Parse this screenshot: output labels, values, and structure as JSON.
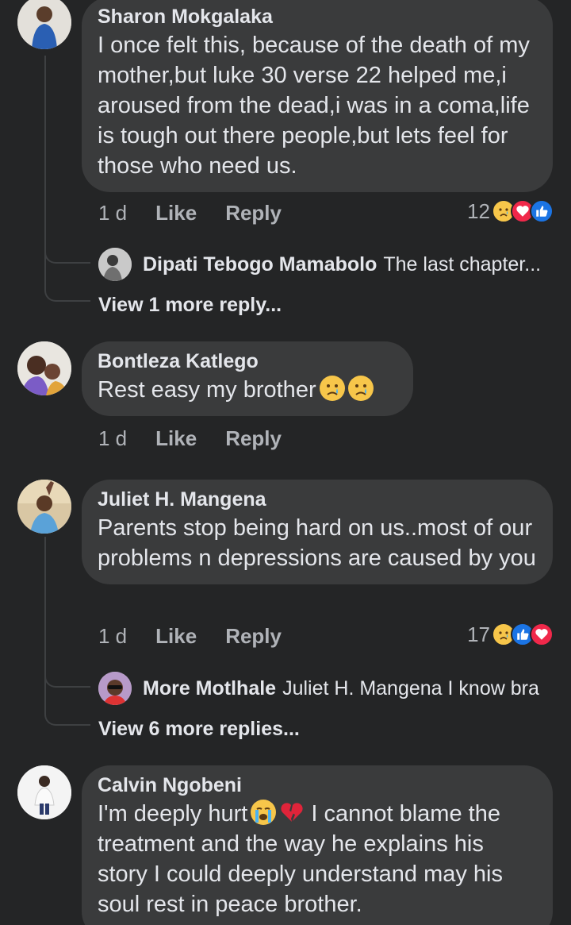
{
  "comments": [
    {
      "author": "Sharon Mokgalaka",
      "text": "I once felt this, because of the death of my mother,but luke 30 verse 22 helped me,i aroused from the dead,i was in a coma,life is tough out there people,but lets feel for those who need us.",
      "time": "1 d",
      "like_label": "Like",
      "reply_label": "Reply",
      "reaction_count": "12",
      "reactions": [
        "sad",
        "love",
        "like"
      ],
      "reply_preview": {
        "author": "Dipati Tebogo Mamabolo",
        "text": "The last chapter..."
      },
      "more_replies": "View 1 more reply..."
    },
    {
      "author": "Bontleza Katlego",
      "text": "Rest easy my brother 😢😢",
      "time": "1 d",
      "like_label": "Like",
      "reply_label": "Reply"
    },
    {
      "author": "Juliet H. Mangena",
      "text": "Parents stop being hard on us..most of our problems n depressions are caused by you",
      "time": "1 d",
      "like_label": "Like",
      "reply_label": "Reply",
      "reaction_count": "17",
      "reactions": [
        "sad",
        "like",
        "love"
      ],
      "reply_preview": {
        "author": "More Motlhale",
        "text": "Juliet H. Mangena I know bra"
      },
      "more_replies": "View 6 more replies..."
    },
    {
      "author": "Calvin Ngobeni",
      "text": "I'm deeply hurt 😭💔 I cannot blame the treatment and the way he explains his story I could deeply understand may his soul rest in peace brother."
    }
  ],
  "colors": {
    "background": "#242526",
    "bubble": "#3a3b3c",
    "primary_text": "#e4e6eb",
    "secondary_text": "#b0b3b8",
    "like_blue": "#1b74e4",
    "love_red": "#f0284a",
    "sad_yellow": "#f7c64a"
  }
}
